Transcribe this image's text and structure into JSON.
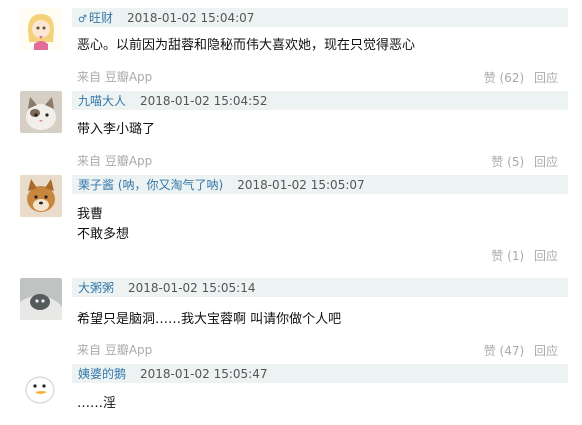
{
  "comments": [
    {
      "username": "旺财",
      "timestamp": "2018-01-02 15:04:07",
      "lines": [
        "恶心。以前因为甜蓉和隐秘而伟大喜欢她，现在只觉得恶心"
      ],
      "source": "来自 豆瓣App",
      "like": "赞 (62)",
      "reply": "回应"
    },
    {
      "username": "九喵大人",
      "timestamp": "2018-01-02 15:04:52",
      "lines": [
        "带入李小璐了"
      ],
      "source": "来自 豆瓣App",
      "like": "赞 (5)",
      "reply": "回应"
    },
    {
      "username": "栗子酱 (呐，你又淘气了呐)",
      "timestamp": "2018-01-02 15:05:07",
      "lines": [
        "我曹",
        "不敢多想"
      ],
      "source": "",
      "like": "赞 (1)",
      "reply": "回应"
    },
    {
      "username": "大粥粥",
      "timestamp": "2018-01-02 15:05:14",
      "lines": [
        "希望只是脑洞……我大宝蓉啊 叫请你做个人吧"
      ],
      "source": "来自 豆瓣App",
      "like": "赞 (47)",
      "reply": "回应"
    },
    {
      "username": "姨婆的鹅",
      "timestamp": "2018-01-02 15:05:47",
      "lines": [
        "……淫"
      ],
      "source": "",
      "like": "",
      "reply": ""
    }
  ]
}
